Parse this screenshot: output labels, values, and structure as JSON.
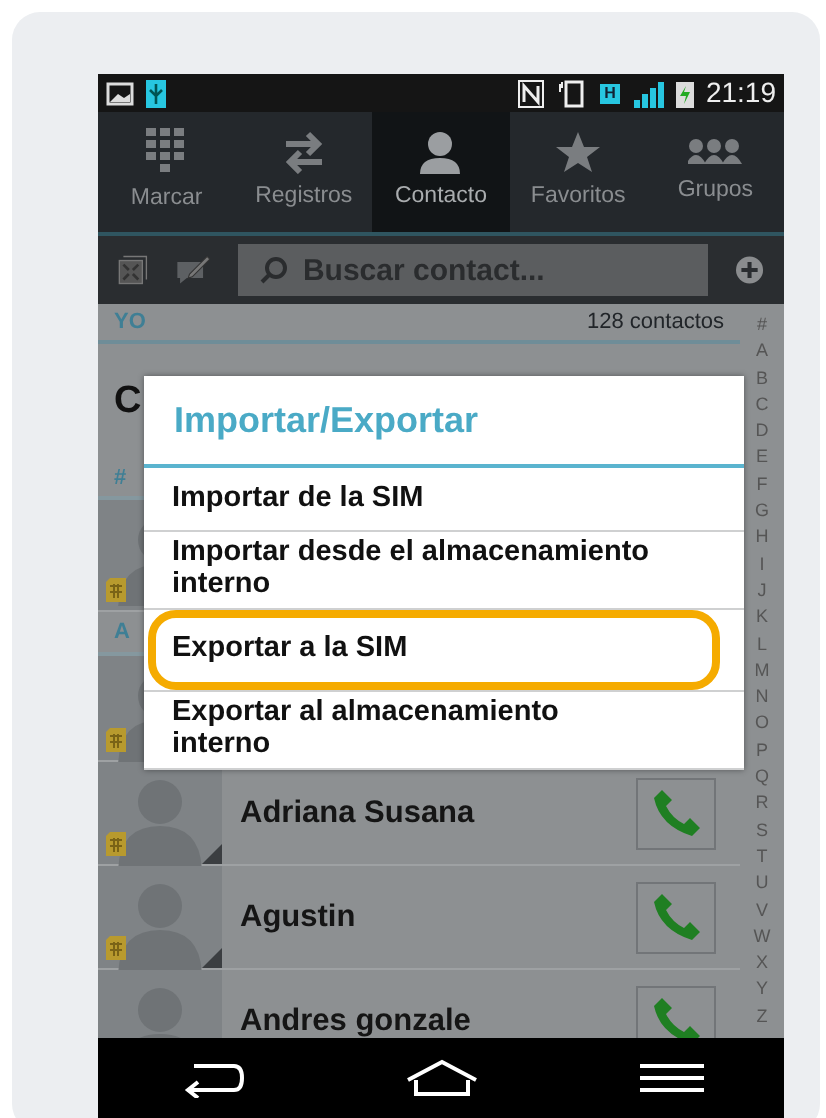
{
  "status_bar": {
    "time": "21:19",
    "network": "H"
  },
  "tabs": [
    {
      "label": "Marcar",
      "selected": false
    },
    {
      "label": "Registros",
      "selected": false
    },
    {
      "label": "Contacto",
      "selected": true
    },
    {
      "label": "Favoritos",
      "selected": false
    },
    {
      "label": "Grupos",
      "selected": false
    }
  ],
  "search": {
    "placeholder": "Buscar contact..."
  },
  "profile_header": {
    "label": "YO",
    "count": "128 contactos"
  },
  "profile_name": "C",
  "sections": [
    {
      "letter": "#",
      "contacts": [
        {
          "sim": true
        }
      ]
    },
    {
      "letter": "A",
      "contacts": [
        {
          "sim": true
        },
        {
          "name": "Adriana Susana",
          "sim": true
        },
        {
          "name": "Agustin",
          "sim": true
        },
        {
          "name": "Andres gonzale"
        }
      ]
    }
  ],
  "index_letters": [
    "#",
    "A",
    "B",
    "C",
    "D",
    "E",
    "F",
    "G",
    "H",
    "I",
    "J",
    "K",
    "L",
    "M",
    "N",
    "O",
    "P",
    "Q",
    "R",
    "S",
    "T",
    "U",
    "V",
    "W",
    "X",
    "Y",
    "Z"
  ],
  "dialog": {
    "title": "Importar/Exportar",
    "items": [
      {
        "label": "Importar de la SIM",
        "highlighted": false
      },
      {
        "label": "Importar desde el almacenamiento interno",
        "highlighted": false
      },
      {
        "label": "Exportar a la SIM",
        "highlighted": true
      },
      {
        "label": "Exportar al almacenamiento interno",
        "highlighted": false
      }
    ]
  }
}
